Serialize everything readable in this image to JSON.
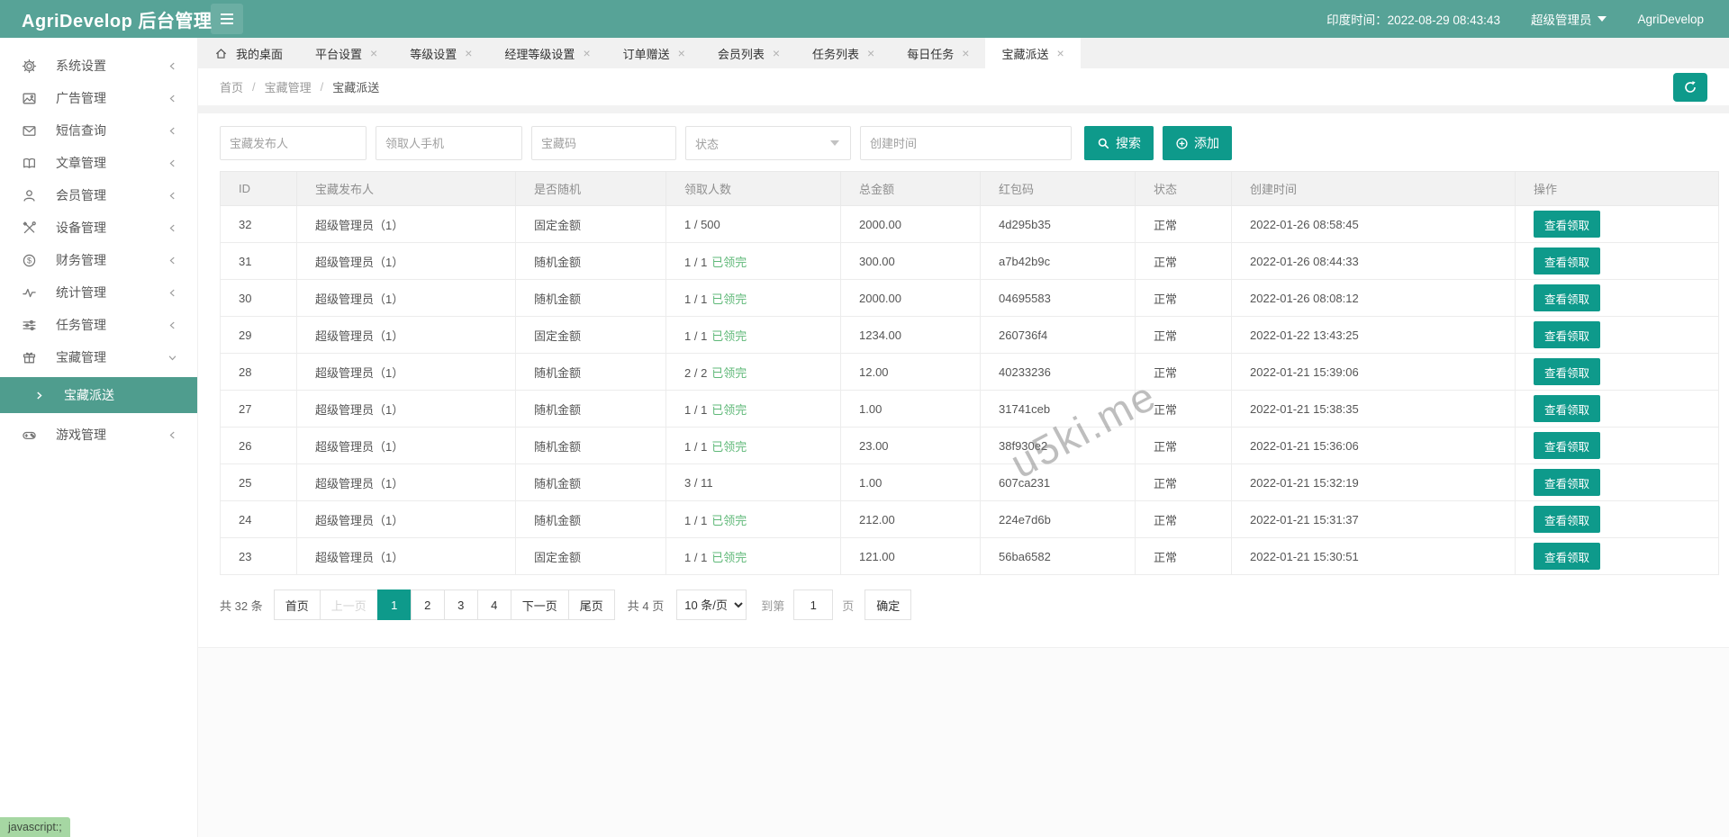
{
  "header": {
    "title": "AgriDevelop 后台管理",
    "time": "印度时间：2022-08-29 08:43:43",
    "user": "超级管理员",
    "brand": "AgriDevelop"
  },
  "sidebar": {
    "items": [
      {
        "label": "系统设置",
        "icon": "gear-icon",
        "chevron": "left"
      },
      {
        "label": "广告管理",
        "icon": "image-icon",
        "chevron": "left"
      },
      {
        "label": "短信查询",
        "icon": "mail-icon",
        "chevron": "left"
      },
      {
        "label": "文章管理",
        "icon": "book-icon",
        "chevron": "left"
      },
      {
        "label": "会员管理",
        "icon": "user-icon",
        "chevron": "left"
      },
      {
        "label": "设备管理",
        "icon": "tools-icon",
        "chevron": "left"
      },
      {
        "label": "财务管理",
        "icon": "dollar-icon",
        "chevron": "left"
      },
      {
        "label": "统计管理",
        "icon": "pulse-icon",
        "chevron": "left"
      },
      {
        "label": "任务管理",
        "icon": "sliders-icon",
        "chevron": "left"
      },
      {
        "label": "宝藏管理",
        "icon": "gift-icon",
        "chevron": "down",
        "expanded": true,
        "children": [
          {
            "label": "宝藏派送",
            "active": true
          }
        ]
      },
      {
        "label": "游戏管理",
        "icon": "gamepad-icon",
        "chevron": "left"
      }
    ]
  },
  "tabs": [
    {
      "label": "我的桌面",
      "home": true,
      "closable": false,
      "active": false
    },
    {
      "label": "平台设置",
      "closable": true,
      "active": false
    },
    {
      "label": "等级设置",
      "closable": true,
      "active": false
    },
    {
      "label": "经理等级设置",
      "closable": true,
      "active": false
    },
    {
      "label": "订单赠送",
      "closable": true,
      "active": false
    },
    {
      "label": "会员列表",
      "closable": true,
      "active": false
    },
    {
      "label": "任务列表",
      "closable": true,
      "active": false
    },
    {
      "label": "每日任务",
      "closable": true,
      "active": false
    },
    {
      "label": "宝藏派送",
      "closable": true,
      "active": true
    }
  ],
  "breadcrumb": [
    "首页",
    "宝藏管理",
    "宝藏派送"
  ],
  "filters": {
    "text_inputs": [
      {
        "name": "publisher",
        "placeholder": "宝藏发布人"
      },
      {
        "name": "phone",
        "placeholder": "领取人手机"
      },
      {
        "name": "treasure-code",
        "placeholder": "宝藏码"
      }
    ],
    "status_select": {
      "placeholder": "状态"
    },
    "date_input": {
      "placeholder": "创建时间"
    },
    "search": "搜索",
    "add": "添加"
  },
  "table": {
    "columns": [
      "ID",
      "宝藏发布人",
      "是否随机",
      "领取人数",
      "总金额",
      "红包码",
      "状态",
      "创建时间",
      "操作"
    ],
    "action_label": "查看领取",
    "rows": [
      {
        "id": "32",
        "publisher": "超级管理员（1）",
        "type": "固定金额",
        "type_color": "green",
        "claims": "1 / 500",
        "claims_tag": "",
        "amount": "2000.00",
        "code": "4d295b35",
        "status": "正常",
        "created": "2022-01-26 08:58:45"
      },
      {
        "id": "31",
        "publisher": "超级管理员（1）",
        "type": "随机金额",
        "type_color": "red",
        "claims": "1 / 1",
        "claims_tag": "已领完",
        "amount": "300.00",
        "code": "a7b42b9c",
        "status": "正常",
        "created": "2022-01-26 08:44:33"
      },
      {
        "id": "30",
        "publisher": "超级管理员（1）",
        "type": "随机金额",
        "type_color": "red",
        "claims": "1 / 1",
        "claims_tag": "已领完",
        "amount": "2000.00",
        "code": "04695583",
        "status": "正常",
        "created": "2022-01-26 08:08:12"
      },
      {
        "id": "29",
        "publisher": "超级管理员（1）",
        "type": "固定金额",
        "type_color": "green",
        "claims": "1 / 1",
        "claims_tag": "已领完",
        "amount": "1234.00",
        "code": "260736f4",
        "status": "正常",
        "created": "2022-01-22 13:43:25"
      },
      {
        "id": "28",
        "publisher": "超级管理员（1）",
        "type": "随机金额",
        "type_color": "red",
        "claims": "2 / 2",
        "claims_tag": "已领完",
        "amount": "12.00",
        "code": "40233236",
        "status": "正常",
        "created": "2022-01-21 15:39:06"
      },
      {
        "id": "27",
        "publisher": "超级管理员（1）",
        "type": "随机金额",
        "type_color": "red",
        "claims": "1 / 1",
        "claims_tag": "已领完",
        "amount": "1.00",
        "code": "31741ceb",
        "status": "正常",
        "created": "2022-01-21 15:38:35"
      },
      {
        "id": "26",
        "publisher": "超级管理员（1）",
        "type": "随机金额",
        "type_color": "red",
        "claims": "1 / 1",
        "claims_tag": "已领完",
        "amount": "23.00",
        "code": "38f930e2",
        "status": "正常",
        "created": "2022-01-21 15:36:06"
      },
      {
        "id": "25",
        "publisher": "超级管理员（1）",
        "type": "随机金额",
        "type_color": "red",
        "claims": "3 / 11",
        "claims_tag": "",
        "amount": "1.00",
        "code": "607ca231",
        "status": "正常",
        "created": "2022-01-21 15:32:19"
      },
      {
        "id": "24",
        "publisher": "超级管理员（1）",
        "type": "随机金额",
        "type_color": "red",
        "claims": "1 / 1",
        "claims_tag": "已领完",
        "amount": "212.00",
        "code": "224e7d6b",
        "status": "正常",
        "created": "2022-01-21 15:31:37"
      },
      {
        "id": "23",
        "publisher": "超级管理员（1）",
        "type": "固定金额",
        "type_color": "green",
        "claims": "1 / 1",
        "claims_tag": "已领完",
        "amount": "121.00",
        "code": "56ba6582",
        "status": "正常",
        "created": "2022-01-21 15:30:51"
      }
    ]
  },
  "pagination": {
    "total_label": "共 32 条",
    "first": "首页",
    "prev": "上一页",
    "pages": [
      "1",
      "2",
      "3",
      "4"
    ],
    "active": "1",
    "next": "下一页",
    "last": "尾页",
    "count_label": "共 4 页",
    "per_page": "10 条/页",
    "goto_prefix": "到第",
    "goto_value": "1",
    "goto_suffix": "页",
    "confirm": "确定"
  },
  "watermark": "u5ki.me",
  "status_bar": "javascript:;",
  "colors": {
    "header_teal": "#57a397",
    "button_teal": "#0e9a8b",
    "menu_active_teal": "#4f9d8e",
    "green": "#5fb878",
    "red": "#ff5722"
  }
}
